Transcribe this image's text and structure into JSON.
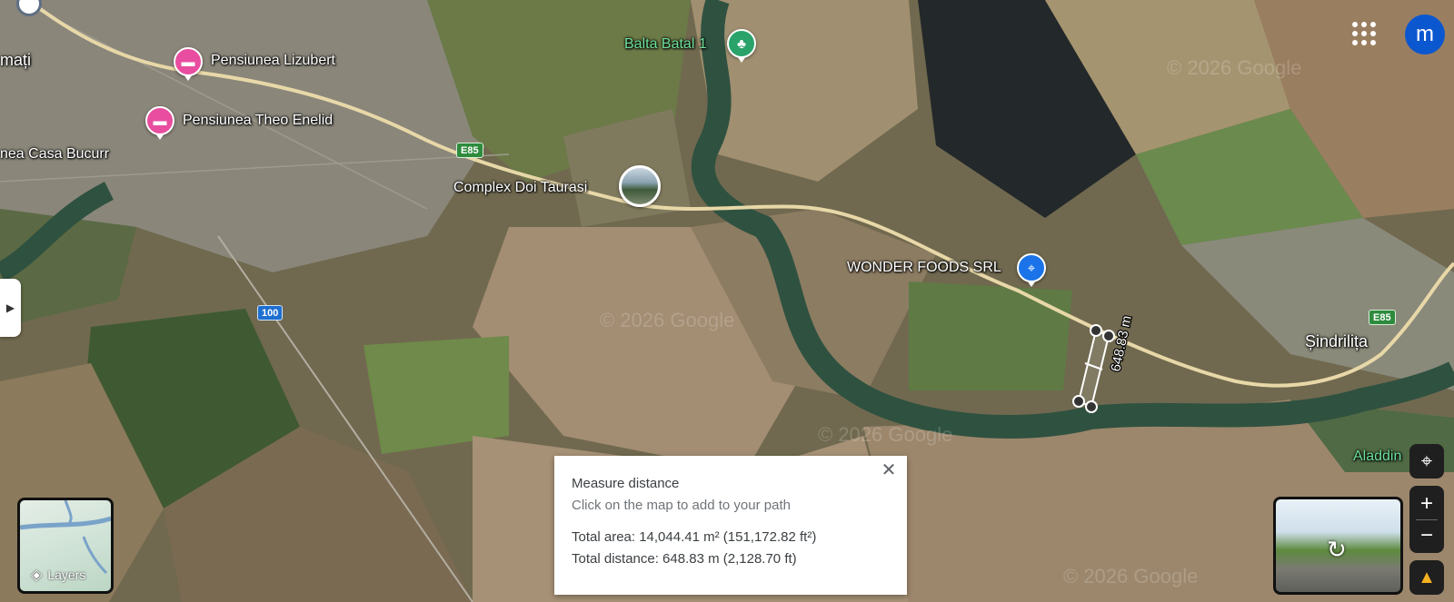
{
  "map": {
    "places": {
      "town_left": "mați",
      "hotel_1": "Pensiunea Lizubert",
      "hotel_2": "Pensiunea Theo Enelid",
      "hotel_3": "nea Casa Bucurr",
      "lake": "Balta Batal 1",
      "complex": "Complex Doi Taurasi",
      "shop": "WONDER FOODS SRL",
      "village": "Șindrilița",
      "aladdin": "Aladdin"
    },
    "roads": {
      "e85": "E85",
      "dn100": "100"
    },
    "measure_label": "648.83 m",
    "watermark": "© 2026 Google"
  },
  "measure_card": {
    "title": "Measure distance",
    "hint": "Click on the map to add to your path",
    "total_area": "Total area: 14,044.41 m² (151,172.82 ft²)",
    "total_distance": "Total distance: 648.83 m (2,128.70 ft)",
    "close_icon": "close-icon"
  },
  "layers": {
    "label": "Layers"
  },
  "account": {
    "initial": "m"
  },
  "colors": {
    "hotel_pin": "#e84d9f",
    "park_pin": "#2aa36a",
    "shop_pin": "#1a73e8",
    "road": "#e8d8a8",
    "avatar": "#0b57d0"
  }
}
